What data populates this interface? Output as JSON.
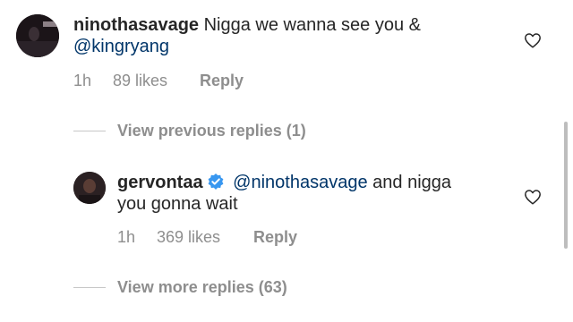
{
  "comment1": {
    "username": "ninothasavage",
    "text": "Nigga we wanna see you &",
    "mention": "@kingryang",
    "time": "1h",
    "likes": "89 likes",
    "reply": "Reply"
  },
  "view_previous": "View previous replies (1)",
  "comment2": {
    "username": "gervontaa",
    "verified": true,
    "mention": "@ninothasavage",
    "text_line1": "and nigga",
    "text_line2": "you gonna wait",
    "time": "1h",
    "likes": "369 likes",
    "reply": "Reply"
  },
  "view_more": "View more replies (63)",
  "colors": {
    "username": "#262626",
    "mention": "#003569",
    "meta": "#8e8e8e",
    "verified": "#3897f0"
  },
  "icons": [
    "heart-outline-icon",
    "verified-badge-icon"
  ]
}
